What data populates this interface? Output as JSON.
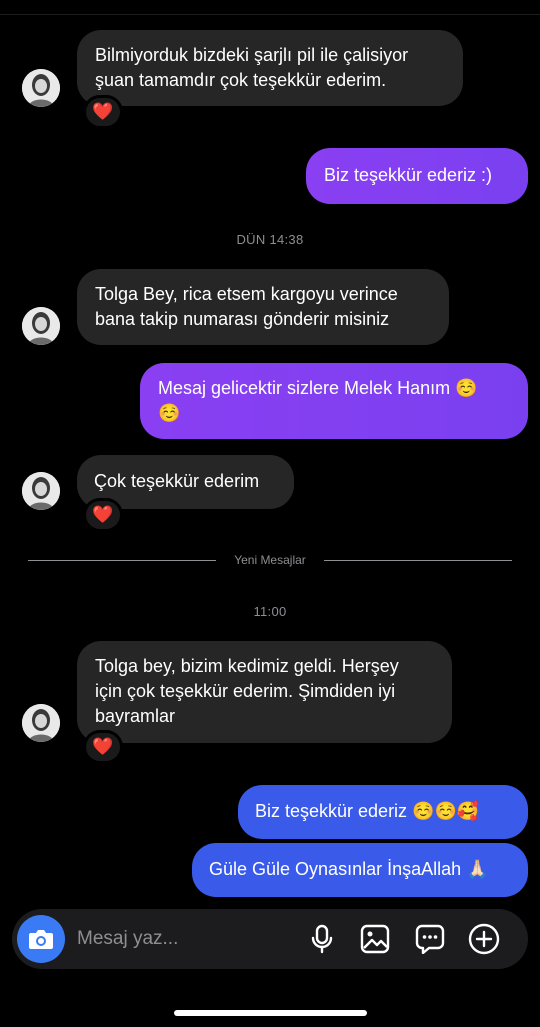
{
  "messages": {
    "m1": {
      "text": "Bilmiyorduk bizdeki şarjlı pil ile çalisiyor\nşuan tamamdır çok teşekkür ederim.",
      "reaction": "❤️"
    },
    "m2": {
      "text": "Biz teşekkür ederiz :)"
    },
    "stamp1": "DÜN 14:38",
    "m3": {
      "text": "Tolga Bey, rica etsem kargoyu verince\nbana takip numarası gönderir misiniz"
    },
    "m4": {
      "text": "Mesaj gelicektir sizlere Melek Hanım ☺️\n☺️"
    },
    "m5": {
      "text": "Çok teşekkür ederim",
      "reaction": "❤️"
    },
    "divider_label": "Yeni Mesajlar",
    "stamp2": "11:00",
    "m6": {
      "text": "Tolga bey, bizim kedimiz geldi. Herşey\niçin çok teşekkür ederim. Şimdiden iyi\nbayramlar",
      "reaction": "❤️"
    },
    "m7": {
      "text": "Biz teşekkür ederiz ☺️☺️🥰"
    },
    "m8": {
      "text": "Güle Güle Oynasınlar İnşaAllah 🙏🏻"
    }
  },
  "composer": {
    "placeholder": "Mesaj yaz...",
    "icons": [
      "camera-icon",
      "microphone-icon",
      "image-icon",
      "sticker-icon",
      "plus-icon"
    ]
  },
  "colors": {
    "outgoing_purple": "#8a3ff2",
    "outgoing_blue": "#3a5bea",
    "incoming": "#262626",
    "camera_button": "#3a7bf5"
  }
}
